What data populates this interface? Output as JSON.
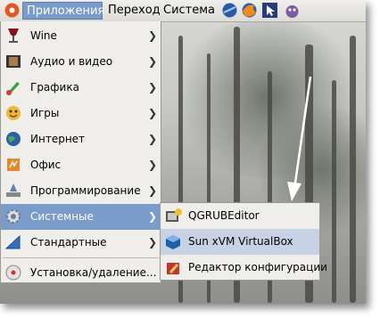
{
  "panel": {
    "menus": [
      "Приложения",
      "Переход",
      "Система"
    ],
    "launchers": [
      "network-icon",
      "firefox-icon",
      "pointer-icon",
      "pidgin-icon"
    ]
  },
  "menu": {
    "items": [
      {
        "label": "Wine",
        "icon": "wine-glass-icon",
        "submenu": true
      },
      {
        "label": "Аудио и видео",
        "icon": "film-icon",
        "submenu": true
      },
      {
        "label": "Графика",
        "icon": "paint-brush-icon",
        "submenu": true
      },
      {
        "label": "Игры",
        "icon": "games-icon",
        "submenu": true
      },
      {
        "label": "Интернет",
        "icon": "globe-icon",
        "submenu": true
      },
      {
        "label": "Офис",
        "icon": "office-icon",
        "submenu": true
      },
      {
        "label": "Программирование",
        "icon": "programming-icon",
        "submenu": true
      },
      {
        "label": "Системные",
        "icon": "gear-icon",
        "submenu": true,
        "selected": true
      },
      {
        "label": "Стандартные",
        "icon": "accessories-icon",
        "submenu": true
      },
      {
        "label": "Установка/удаление...",
        "icon": "install-disc-icon",
        "submenu": false
      }
    ]
  },
  "submenu": {
    "items": [
      {
        "label": "QGRUBEditor",
        "icon": "grub-editor-icon"
      },
      {
        "label": "Sun xVM VirtualBox",
        "icon": "virtualbox-icon",
        "selected": true
      },
      {
        "label": "Редактор конфигурации",
        "icon": "config-editor-icon"
      }
    ]
  },
  "colors": {
    "selection": "#7a9ccb",
    "hover": "#c7d3e5",
    "menu_bg": "#efeeea"
  }
}
